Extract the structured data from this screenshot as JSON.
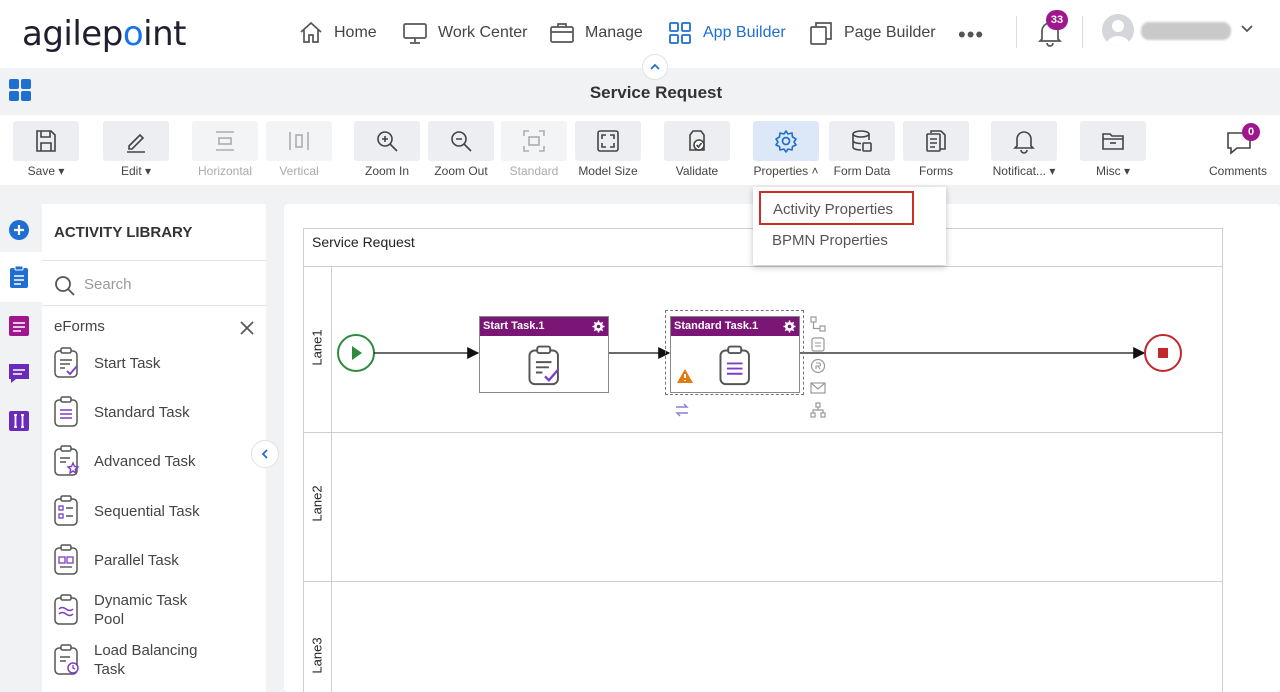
{
  "brand": {
    "logo_text_a": "agilep",
    "logo_text_b": "int"
  },
  "nav": {
    "items": [
      {
        "label": "Home",
        "icon": "home-icon"
      },
      {
        "label": "Work Center",
        "icon": "monitor-icon"
      },
      {
        "label": "Manage",
        "icon": "briefcase-icon"
      },
      {
        "label": "App Builder",
        "icon": "grid-icon",
        "active": true
      },
      {
        "label": "Page Builder",
        "icon": "pages-icon"
      }
    ],
    "more": "•••",
    "notification_count": "33"
  },
  "page": {
    "title": "Service Request"
  },
  "toolbar": {
    "save": "Save",
    "edit": "Edit",
    "horizontal": "Horizontal",
    "vertical": "Vertical",
    "zoom_in": "Zoom In",
    "zoom_out": "Zoom Out",
    "standard": "Standard",
    "model_size": "Model Size",
    "validate": "Validate",
    "properties": "Properties",
    "form_data": "Form Data",
    "forms": "Forms",
    "notifications": "Notificat...",
    "misc": "Misc",
    "comments": "Comments",
    "comments_count": "0"
  },
  "properties_menu": {
    "items": [
      "Activity Properties",
      "BPMN Properties"
    ]
  },
  "library": {
    "title": "ACTIVITY LIBRARY",
    "search_placeholder": "Search",
    "category": "eForms",
    "items": [
      {
        "label": "Start Task"
      },
      {
        "label": "Standard Task"
      },
      {
        "label": "Advanced Task"
      },
      {
        "label": "Sequential Task"
      },
      {
        "label": "Parallel Task"
      },
      {
        "label": "Dynamic Task Pool"
      },
      {
        "label": "Load Balancing Task"
      }
    ]
  },
  "diagram": {
    "pool_name": "Service Request",
    "lanes": [
      "Lane1",
      "Lane2",
      "Lane3"
    ],
    "tasks": [
      {
        "title": "Start Task.1"
      },
      {
        "title": "Standard Task.1"
      }
    ]
  },
  "colors": {
    "accent": "#1e6fd1",
    "task_header": "#7b1677",
    "start_event": "#2e8b3e",
    "end_event": "#c0282e",
    "badge": "#a0168c",
    "highlight": "#d02b2b"
  }
}
